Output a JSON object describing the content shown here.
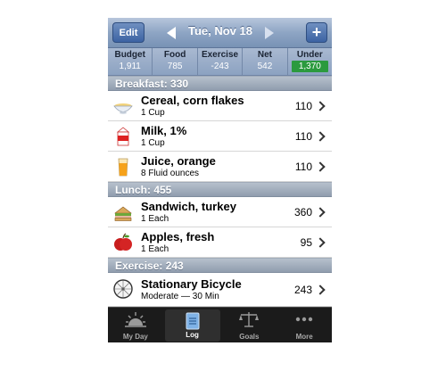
{
  "navbar": {
    "edit_label": "Edit",
    "date": "Tue, Nov 18",
    "add_label": "+"
  },
  "summary": [
    {
      "label": "Budget",
      "value": "1,911"
    },
    {
      "label": "Food",
      "value": "785"
    },
    {
      "label": "Exercise",
      "value": "-243"
    },
    {
      "label": "Net",
      "value": "542"
    },
    {
      "label": "Under",
      "value": "1,370"
    }
  ],
  "sections": {
    "breakfast": "Breakfast: 330",
    "lunch": "Lunch: 455",
    "exercise": "Exercise: 243"
  },
  "items": [
    {
      "title": "Cereal, corn flakes",
      "sub": "1 Cup",
      "cal": "110",
      "icon": "cereal-bowl-icon"
    },
    {
      "title": "Milk, 1%",
      "sub": "1 Cup",
      "cal": "110",
      "icon": "milk-carton-icon"
    },
    {
      "title": "Juice, orange",
      "sub": "8 Fluid ounces",
      "cal": "110",
      "icon": "juice-glass-icon"
    },
    {
      "title": "Sandwich, turkey",
      "sub": "1 Each",
      "cal": "360",
      "icon": "sandwich-icon"
    },
    {
      "title": "Apples, fresh",
      "sub": "1 Each",
      "cal": "95",
      "icon": "apple-icon"
    },
    {
      "title": "Stationary Bicycle",
      "sub": "Moderate — 30 Min",
      "cal": "243",
      "icon": "bicycle-wheel-icon"
    }
  ],
  "tabs": [
    {
      "label": "My Day",
      "icon": "sunrise-icon"
    },
    {
      "label": "Log",
      "icon": "log-book-icon"
    },
    {
      "label": "Goals",
      "icon": "scale-icon"
    },
    {
      "label": "More",
      "icon": "more-dots-icon"
    }
  ],
  "colors": {
    "under_badge": "#2b9a3e",
    "navbar": "#8ea5c4",
    "tabbar": "#1b1b1b"
  }
}
